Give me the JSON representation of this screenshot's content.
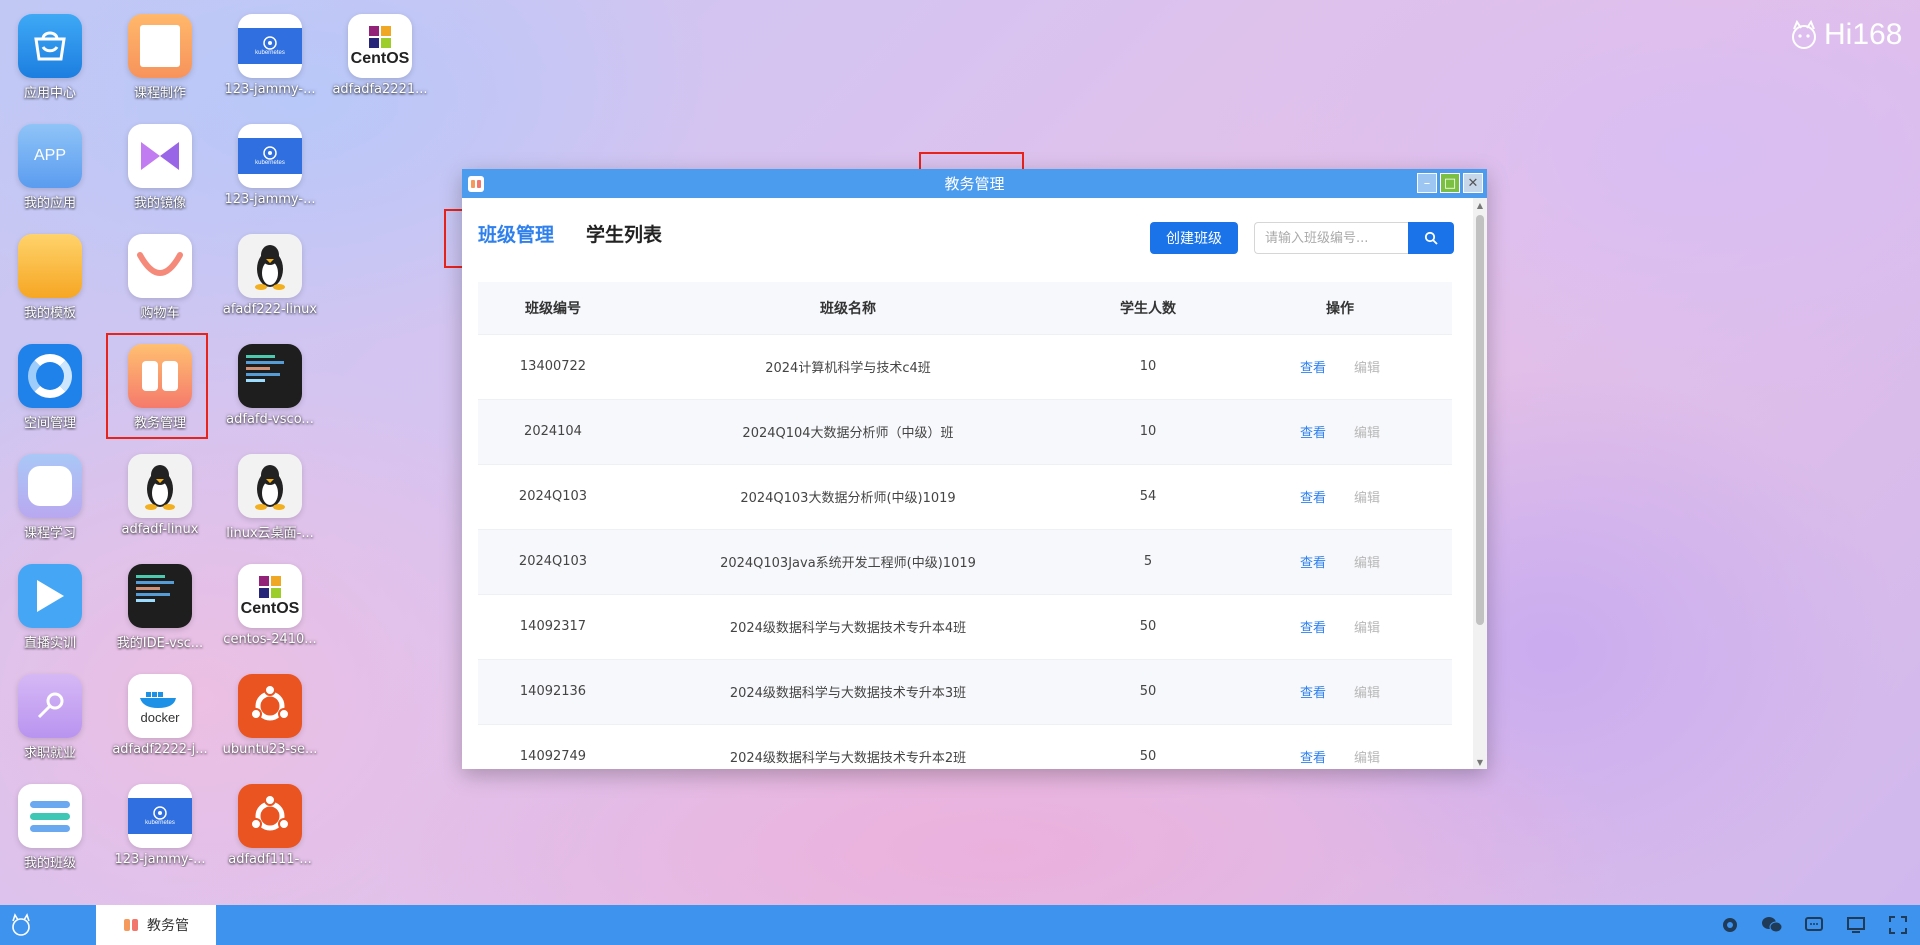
{
  "brand": {
    "logo_text": "Hi168"
  },
  "desktop_icons": [
    {
      "label": "应用中心",
      "icon": "app-store-icon"
    },
    {
      "label": "我的应用",
      "icon": "my-apps-icon",
      "badge": "APP"
    },
    {
      "label": "我的模板",
      "icon": "folder-icon"
    },
    {
      "label": "空间管理",
      "icon": "space-manage-icon"
    },
    {
      "label": "课程学习",
      "icon": "course-study-icon"
    },
    {
      "label": "直播实训",
      "icon": "live-play-icon"
    },
    {
      "label": "求职就业",
      "icon": "job-icon"
    },
    {
      "label": "我的班级",
      "icon": "my-class-icon"
    },
    {
      "label": "课程制作",
      "icon": "course-make-icon"
    },
    {
      "label": "我的镜像",
      "icon": "mirror-icon"
    },
    {
      "label": "购物车",
      "icon": "cart-icon"
    },
    {
      "label": "教务管理",
      "icon": "edu-manage-icon"
    },
    {
      "label": "adfadf-linux",
      "icon": "linux-penguin-icon"
    },
    {
      "label": "我的IDE-vsc...",
      "icon": "vscode-icon"
    },
    {
      "label": "adfadf2222-j...",
      "icon": "docker-icon",
      "badge": "docker"
    },
    {
      "label": "123-jammy-...",
      "icon": "kubernetes-icon",
      "badge": "kubernetes"
    },
    {
      "label": "123-jammy-...",
      "icon": "kubernetes-icon",
      "badge": "kubernetes"
    },
    {
      "label": "123-jammy-...",
      "icon": "kubernetes-icon",
      "badge": "kubernetes"
    },
    {
      "label": "afadf222-linux",
      "icon": "linux-penguin-icon"
    },
    {
      "label": "adfafd-vsco...",
      "icon": "vscode-icon"
    },
    {
      "label": "linux云桌面-...",
      "icon": "linux-penguin-icon"
    },
    {
      "label": "centos-2410...",
      "icon": "centos-icon",
      "badge": "CentOS"
    },
    {
      "label": "ubuntu23-se...",
      "icon": "ubuntu-icon"
    },
    {
      "label": "adfadf111-...",
      "icon": "ubuntu-icon"
    },
    {
      "label": "adfadfa2221...",
      "icon": "centos-icon",
      "badge": "CentOS"
    }
  ],
  "window": {
    "title": "教务管理",
    "tabs": [
      {
        "label": "班级管理",
        "active": true
      },
      {
        "label": "学生列表",
        "active": false
      }
    ],
    "create_button": "创建班级",
    "search": {
      "placeholder": "请输入班级编号...",
      "value": ""
    },
    "table": {
      "headers": [
        "班级编号",
        "班级名称",
        "学生人数",
        "操作"
      ],
      "rows": [
        {
          "id": "13400722",
          "name": "2024计算机科学与技术c4班",
          "count": "10"
        },
        {
          "id": "2024104",
          "name": "2024Q104大数据分析师（中级）班",
          "count": "10"
        },
        {
          "id": "2024Q103",
          "name": "2024Q103大数据分析师(中级)1019",
          "count": "54"
        },
        {
          "id": "2024Q103",
          "name": "2024Q103Java系统开发工程师(中级)1019",
          "count": "5"
        },
        {
          "id": "14092317",
          "name": "2024级数据科学与大数据技术专升本4班",
          "count": "50"
        },
        {
          "id": "14092136",
          "name": "2024级数据科学与大数据技术专升本3班",
          "count": "50"
        },
        {
          "id": "14092749",
          "name": "2024级数据科学与大数据技术专升本2班",
          "count": "50"
        }
      ],
      "action_view": "查看",
      "action_edit": "编辑"
    }
  },
  "taskbar": {
    "task_label": "教务管",
    "tray_icons": [
      "gear-icon",
      "wechat-icon",
      "chat-icon",
      "monitor-icon",
      "fullscreen-icon"
    ]
  },
  "colors": {
    "accent": "#1a73e8",
    "titlebar": "#4b9cef",
    "taskbar": "#3d93ee",
    "highlight": "#e8231b"
  }
}
